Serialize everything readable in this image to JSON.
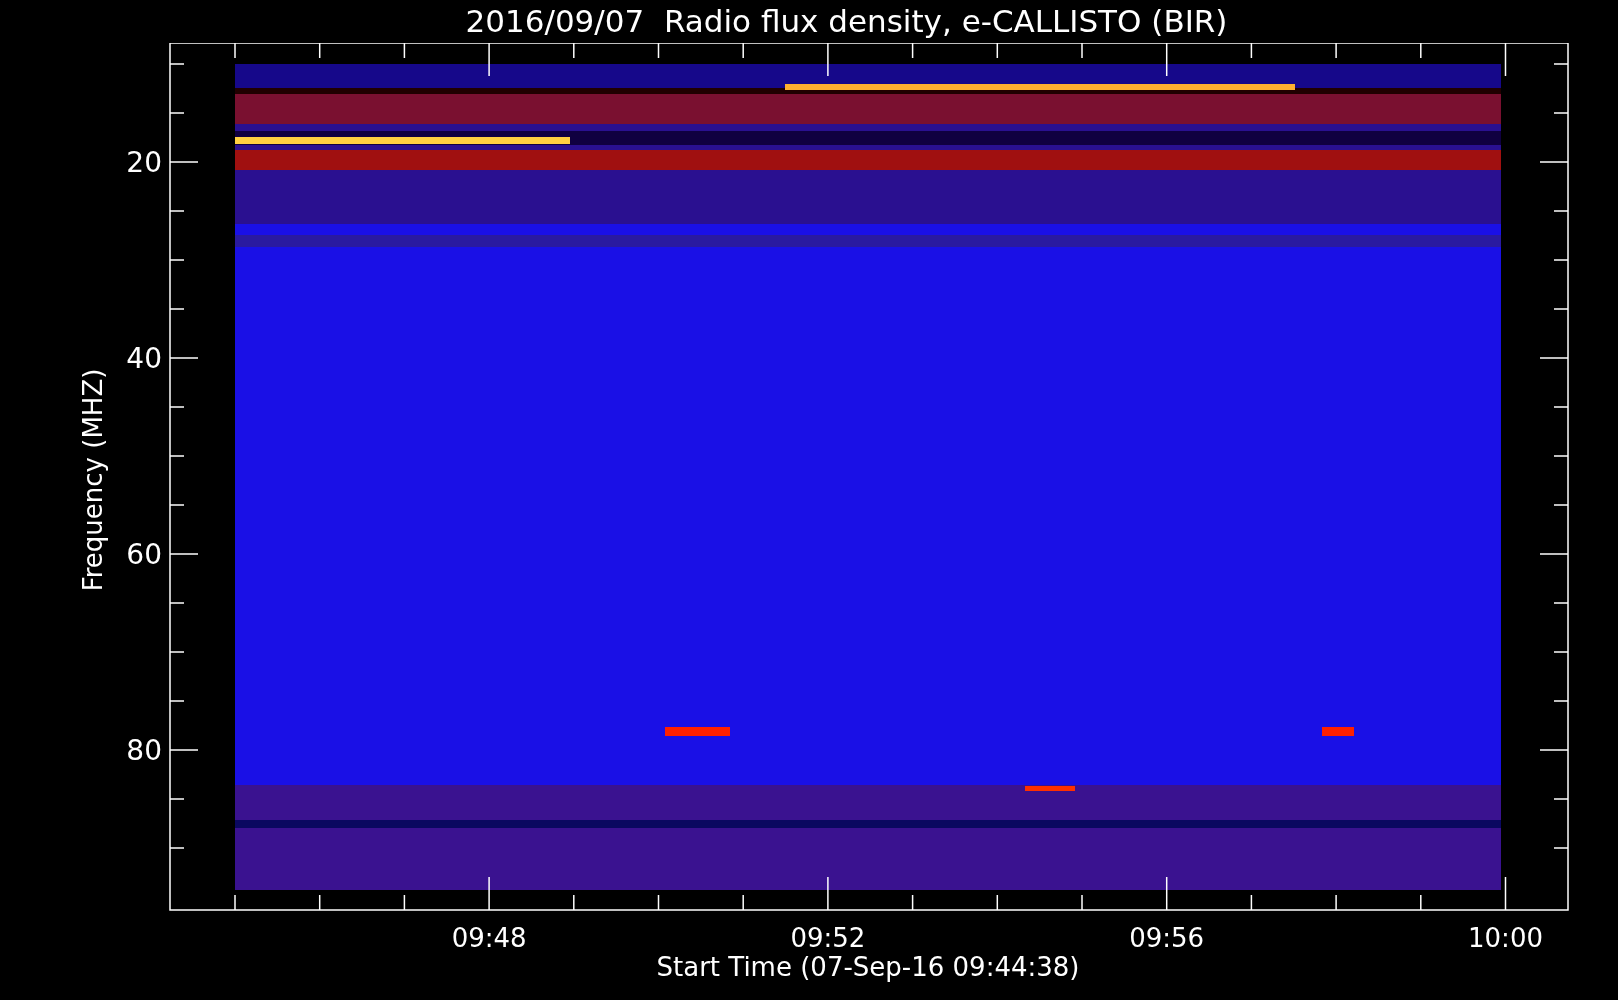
{
  "title": "2016/09/07  Radio flux density, e-CALLISTO (BIR)",
  "y_axis": {
    "label": "Frequency (MHZ)",
    "ticks": [
      "20",
      "40",
      "60",
      "80"
    ]
  },
  "x_axis": {
    "label": "Start Time (07-Sep-16 09:44:38)",
    "ticks": [
      "09:48",
      "09:52",
      "09:56",
      "10:00"
    ]
  }
}
